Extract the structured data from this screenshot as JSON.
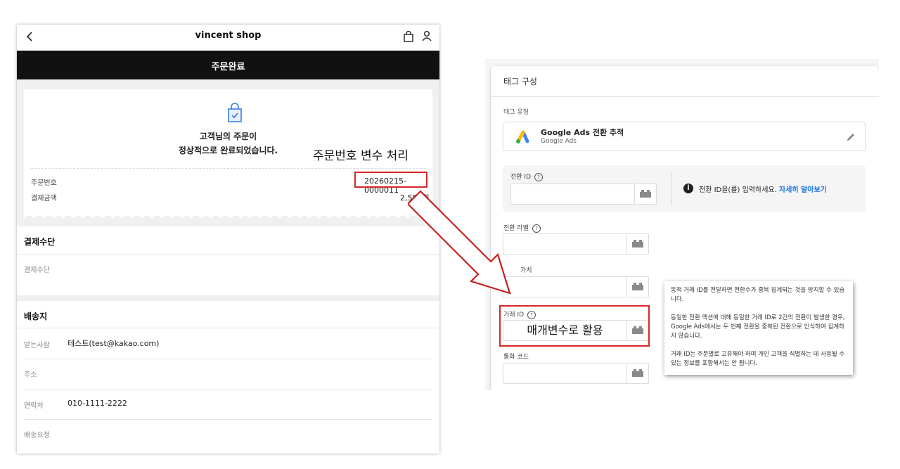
{
  "shop": {
    "title": "vincent shop",
    "order_complete": "주문완료",
    "message_line1": "고객님의 주문이",
    "message_line2": "정상적으로 완료되었습니다.",
    "order_number_label": "주문번호",
    "order_number": "20260215-0000011",
    "amount_label": "결제금액",
    "amount": "2,550원",
    "payment_section_title": "결제수단",
    "payment_method_label": "결제수단",
    "shipping_section_title": "배송지",
    "receiver_label": "받는사람",
    "receiver_value": "테스트(test@kakao.com)",
    "address_label": "주소",
    "phone_label": "연락처",
    "phone_value": "010-1111-2222",
    "request_label": "배송요청"
  },
  "annotations": {
    "order_variable": "주문번호 변수 처리",
    "param_usage": "매개변수로 활용"
  },
  "gtm": {
    "title": "태그 구성",
    "tag_type_label": "태그 유형",
    "tag_name": "Google Ads 전환 추적",
    "tag_sub": "Google Ads",
    "conversion_id_label": "전환 ID",
    "info_text": "전환 ID을(를) 입력하세요.",
    "learn_more": "자세히 알아보기",
    "conversion_label_label": "전환 라벨",
    "value_label_fragment": "가치",
    "transaction_id_label": "거래 ID",
    "currency_code_label": "통화 코드",
    "help_glyph": "?",
    "info_glyph": "i"
  },
  "tooltip": {
    "p1": "동적 거래 ID를 전달하면 전환수가 중복 집계되는 것을 방지할 수 있습니다.",
    "p2": "동일한 전환 액션에 대해 동일한 거래 ID로 2건의 전환이 발생한 경우, Google Ads에서는 두 번째 전환을 중복된 전환으로 인식하여 집계하지 않습니다.",
    "p3": "거래 ID는 주문별로 고유해야 하며 개인 고객을 식별하는 데 사용될 수 있는 정보를 포함해서는 안 됩니다."
  },
  "colors": {
    "annotation_red": "#d62828",
    "link_blue": "#1a73e8",
    "header_black": "#111111"
  },
  "icons": [
    "back-arrow-icon",
    "shopping-bag-icon",
    "user-icon",
    "shopping-bag-check-icon",
    "google-ads-logo-icon",
    "pencil-edit-icon",
    "help-circle-icon",
    "info-icon",
    "variable-picker-icon",
    "red-arrow-icon"
  ]
}
